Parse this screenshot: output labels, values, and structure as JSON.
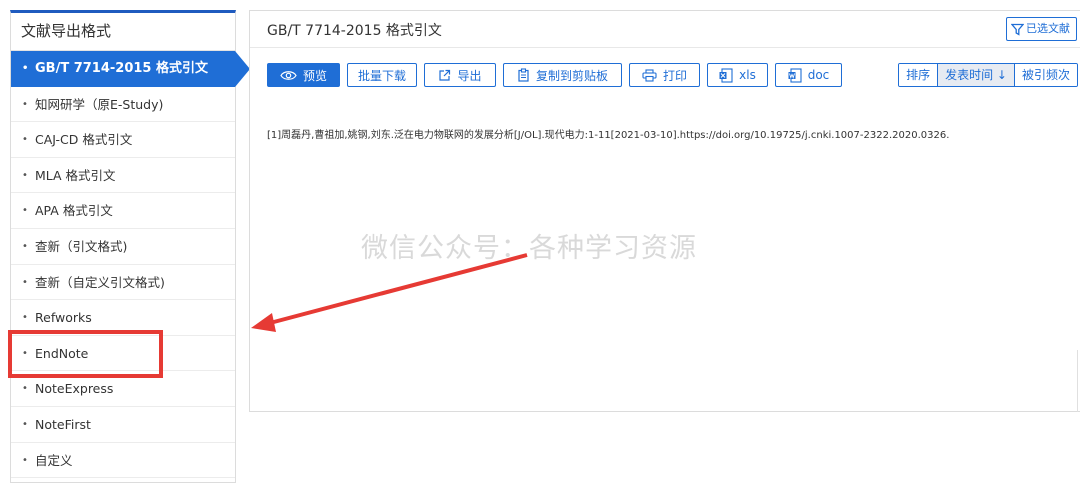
{
  "sidebar": {
    "header": "文献导出格式",
    "items": [
      {
        "label": "GB/T 7714-2015 格式引文",
        "active": true
      },
      {
        "label": "知网研学（原E-Study)"
      },
      {
        "label": "CAJ-CD 格式引文"
      },
      {
        "label": "MLA 格式引文"
      },
      {
        "label": "APA 格式引文"
      },
      {
        "label": "查新（引文格式)"
      },
      {
        "label": "查新（自定义引文格式)"
      },
      {
        "label": "Refworks"
      },
      {
        "label": "EndNote"
      },
      {
        "label": "NoteExpress"
      },
      {
        "label": "NoteFirst"
      },
      {
        "label": "自定义"
      }
    ]
  },
  "main": {
    "title": "GB/T 7714-2015 格式引文",
    "selected_label": "已选文献",
    "toolbar": {
      "preview": "预览",
      "batch_download": "批量下载",
      "export": "导出",
      "copy": "复制到剪贴板",
      "print": "打印",
      "xls": "xls",
      "doc": "doc"
    },
    "sort": {
      "label": "排序",
      "date": "发表时间",
      "cited": "被引频次"
    },
    "citation": "[1]周磊丹,曹祖加,姚钢,刘东.泛在电力物联网的发展分析[J/OL].现代电力:1-11[2021-03-10].https://doi.org/10.19725/j.cnki.1007-2322.2020.0326."
  },
  "watermark": "微信公众号：各种学习资源",
  "colors": {
    "accent": "#1f6ed6",
    "highlight": "#e63a34"
  }
}
